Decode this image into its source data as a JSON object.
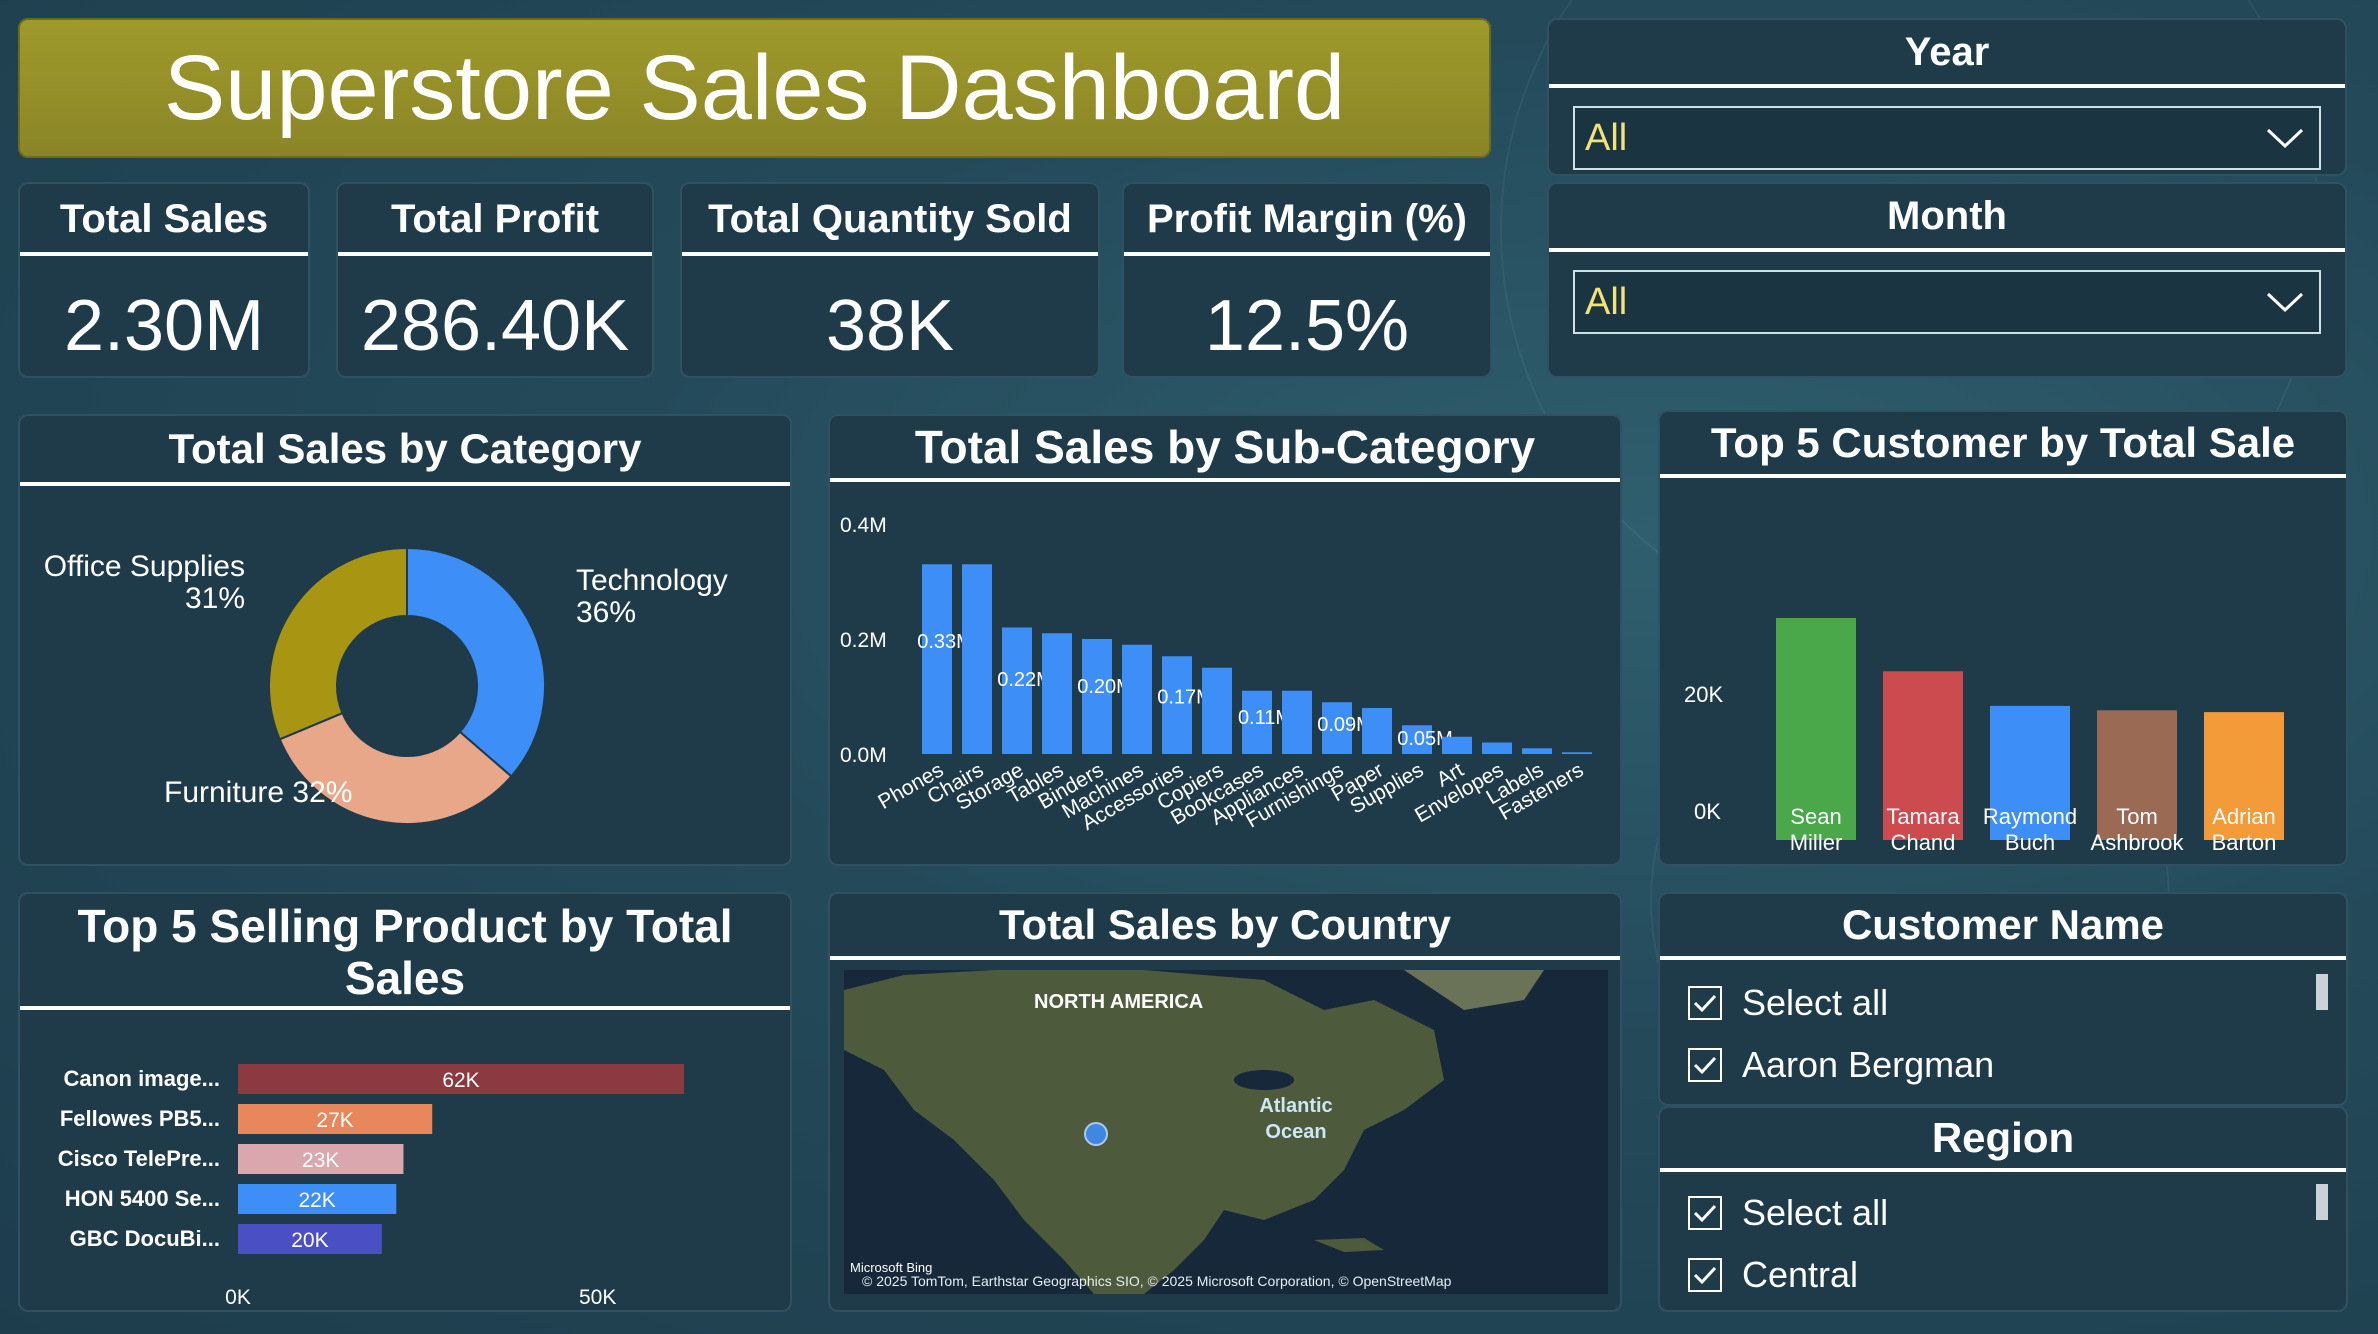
{
  "header": {
    "title": "Superstore Sales Dashboard"
  },
  "kpis": [
    {
      "label": "Total Sales",
      "value": "2.30M"
    },
    {
      "label": "Total Profit",
      "value": "286.40K"
    },
    {
      "label": "Total Quantity Sold",
      "value": "38K"
    },
    {
      "label": "Profit Margin (%)",
      "value": "12.5%"
    }
  ],
  "slicers": {
    "year": {
      "label": "Year",
      "value": "All"
    },
    "month": {
      "label": "Month",
      "value": "All"
    },
    "customer": {
      "label": "Customer Name",
      "items": [
        "Select all",
        "Aaron Bergman"
      ]
    },
    "region": {
      "label": "Region",
      "items": [
        "Select all",
        "Central"
      ]
    }
  },
  "colors": {
    "accent_gold": "#9f9a2a",
    "slicer_value": "#f2e27a",
    "blue": "#3d8ef7",
    "green": "#4aa84a",
    "red": "#cc4b4f",
    "brown": "#9b6a55",
    "orange": "#f29b38",
    "salmon": "#e8a789",
    "olive": "#a89512"
  },
  "map": {
    "title": "Total Sales by Country",
    "labels": {
      "continent": "NORTH AMERICA",
      "ocean": "Atlantic Ocean"
    },
    "attribution": "© 2025 TomTom, Earthstar Geographics SIO, © 2025 Microsoft Corporation, © OpenStreetMap",
    "logo": "Microsoft Bing"
  },
  "chart_data": [
    {
      "type": "pie",
      "title": "Total Sales by Category",
      "slices": [
        {
          "name": "Technology",
          "percent": 36,
          "label": "36%",
          "color": "#3d8ef7"
        },
        {
          "name": "Furniture",
          "percent": 32,
          "label": "32%",
          "color": "#e8a789"
        },
        {
          "name": "Office Supplies",
          "percent": 31,
          "label": "31%",
          "color": "#a89512"
        }
      ]
    },
    {
      "type": "bar",
      "title": "Total Sales by Sub-Category",
      "categories": [
        "Phones",
        "Chairs",
        "Storage",
        "Tables",
        "Binders",
        "Machines",
        "Accessories",
        "Copiers",
        "Bookcases",
        "Appliances",
        "Furnishings",
        "Paper",
        "Supplies",
        "Art",
        "Envelopes",
        "Labels",
        "Fasteners"
      ],
      "values": [
        0.33,
        0.33,
        0.22,
        0.21,
        0.2,
        0.19,
        0.17,
        0.15,
        0.11,
        0.11,
        0.09,
        0.08,
        0.05,
        0.03,
        0.02,
        0.01,
        0.003
      ],
      "data_labels": [
        "0.33M",
        "",
        "0.22M",
        "",
        "0.20M",
        "",
        "0.17M",
        "",
        "0.11M",
        "",
        "0.09M",
        "",
        "0.05M",
        "",
        "",
        "",
        ""
      ],
      "yticks": [
        "0.0M",
        "0.2M",
        "0.4M"
      ],
      "ylim": [
        0,
        0.4
      ],
      "color": "#3d8ef7"
    },
    {
      "type": "bar",
      "title": "Top 5 Customer by Total Sale",
      "categories": [
        "Sean Miller",
        "Tamara Chand",
        "Raymond Buch",
        "Tom Ashbrook",
        "Adrian Barton"
      ],
      "category_lines": [
        [
          "Sean",
          "Miller"
        ],
        [
          "Tamara",
          "Chand"
        ],
        [
          "Raymond",
          "Buch"
        ],
        [
          "Tom",
          "Ashbrook"
        ],
        [
          "Adrian",
          "Barton"
        ]
      ],
      "values": [
        25000,
        19000,
        15100,
        14600,
        14400
      ],
      "colors": [
        "#4aa84a",
        "#cc4b4f",
        "#3d8ef7",
        "#9b6a55",
        "#f29b38"
      ],
      "yticks": [
        "0K",
        "20K"
      ],
      "ylim": [
        0,
        30000
      ]
    },
    {
      "type": "bar",
      "orientation": "horizontal",
      "title": "Top 5 Selling Product by Total Sales",
      "categories": [
        "Canon image...",
        "Fellowes PB5...",
        "Cisco TelePre...",
        "HON 5400 Se...",
        "GBC DocuBi..."
      ],
      "values": [
        62,
        27,
        23,
        22,
        20
      ],
      "data_labels": [
        "62K",
        "27K",
        "23K",
        "22K",
        "20K"
      ],
      "colors": [
        "#8a3a40",
        "#e8875c",
        "#d9a7ad",
        "#3d8ef7",
        "#4a4fc4"
      ],
      "xticks": [
        "0K",
        "50K"
      ],
      "xlim": [
        0,
        100
      ]
    }
  ]
}
